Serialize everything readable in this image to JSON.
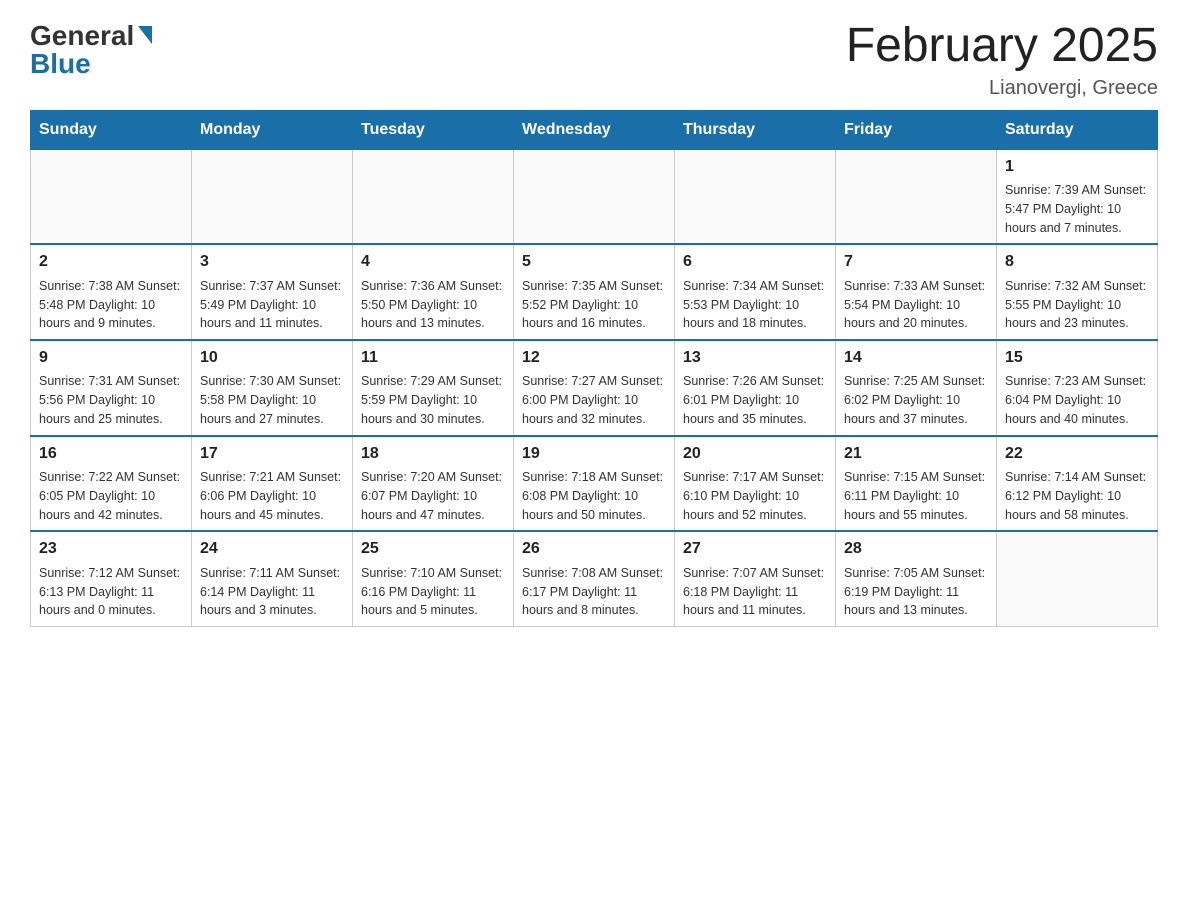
{
  "header": {
    "logo_general": "General",
    "logo_blue": "Blue",
    "title": "February 2025",
    "location": "Lianovergi, Greece"
  },
  "days_of_week": [
    "Sunday",
    "Monday",
    "Tuesday",
    "Wednesday",
    "Thursday",
    "Friday",
    "Saturday"
  ],
  "weeks": [
    [
      {
        "day": "",
        "info": ""
      },
      {
        "day": "",
        "info": ""
      },
      {
        "day": "",
        "info": ""
      },
      {
        "day": "",
        "info": ""
      },
      {
        "day": "",
        "info": ""
      },
      {
        "day": "",
        "info": ""
      },
      {
        "day": "1",
        "info": "Sunrise: 7:39 AM\nSunset: 5:47 PM\nDaylight: 10 hours\nand 7 minutes."
      }
    ],
    [
      {
        "day": "2",
        "info": "Sunrise: 7:38 AM\nSunset: 5:48 PM\nDaylight: 10 hours\nand 9 minutes."
      },
      {
        "day": "3",
        "info": "Sunrise: 7:37 AM\nSunset: 5:49 PM\nDaylight: 10 hours\nand 11 minutes."
      },
      {
        "day": "4",
        "info": "Sunrise: 7:36 AM\nSunset: 5:50 PM\nDaylight: 10 hours\nand 13 minutes."
      },
      {
        "day": "5",
        "info": "Sunrise: 7:35 AM\nSunset: 5:52 PM\nDaylight: 10 hours\nand 16 minutes."
      },
      {
        "day": "6",
        "info": "Sunrise: 7:34 AM\nSunset: 5:53 PM\nDaylight: 10 hours\nand 18 minutes."
      },
      {
        "day": "7",
        "info": "Sunrise: 7:33 AM\nSunset: 5:54 PM\nDaylight: 10 hours\nand 20 minutes."
      },
      {
        "day": "8",
        "info": "Sunrise: 7:32 AM\nSunset: 5:55 PM\nDaylight: 10 hours\nand 23 minutes."
      }
    ],
    [
      {
        "day": "9",
        "info": "Sunrise: 7:31 AM\nSunset: 5:56 PM\nDaylight: 10 hours\nand 25 minutes."
      },
      {
        "day": "10",
        "info": "Sunrise: 7:30 AM\nSunset: 5:58 PM\nDaylight: 10 hours\nand 27 minutes."
      },
      {
        "day": "11",
        "info": "Sunrise: 7:29 AM\nSunset: 5:59 PM\nDaylight: 10 hours\nand 30 minutes."
      },
      {
        "day": "12",
        "info": "Sunrise: 7:27 AM\nSunset: 6:00 PM\nDaylight: 10 hours\nand 32 minutes."
      },
      {
        "day": "13",
        "info": "Sunrise: 7:26 AM\nSunset: 6:01 PM\nDaylight: 10 hours\nand 35 minutes."
      },
      {
        "day": "14",
        "info": "Sunrise: 7:25 AM\nSunset: 6:02 PM\nDaylight: 10 hours\nand 37 minutes."
      },
      {
        "day": "15",
        "info": "Sunrise: 7:23 AM\nSunset: 6:04 PM\nDaylight: 10 hours\nand 40 minutes."
      }
    ],
    [
      {
        "day": "16",
        "info": "Sunrise: 7:22 AM\nSunset: 6:05 PM\nDaylight: 10 hours\nand 42 minutes."
      },
      {
        "day": "17",
        "info": "Sunrise: 7:21 AM\nSunset: 6:06 PM\nDaylight: 10 hours\nand 45 minutes."
      },
      {
        "day": "18",
        "info": "Sunrise: 7:20 AM\nSunset: 6:07 PM\nDaylight: 10 hours\nand 47 minutes."
      },
      {
        "day": "19",
        "info": "Sunrise: 7:18 AM\nSunset: 6:08 PM\nDaylight: 10 hours\nand 50 minutes."
      },
      {
        "day": "20",
        "info": "Sunrise: 7:17 AM\nSunset: 6:10 PM\nDaylight: 10 hours\nand 52 minutes."
      },
      {
        "day": "21",
        "info": "Sunrise: 7:15 AM\nSunset: 6:11 PM\nDaylight: 10 hours\nand 55 minutes."
      },
      {
        "day": "22",
        "info": "Sunrise: 7:14 AM\nSunset: 6:12 PM\nDaylight: 10 hours\nand 58 minutes."
      }
    ],
    [
      {
        "day": "23",
        "info": "Sunrise: 7:12 AM\nSunset: 6:13 PM\nDaylight: 11 hours\nand 0 minutes."
      },
      {
        "day": "24",
        "info": "Sunrise: 7:11 AM\nSunset: 6:14 PM\nDaylight: 11 hours\nand 3 minutes."
      },
      {
        "day": "25",
        "info": "Sunrise: 7:10 AM\nSunset: 6:16 PM\nDaylight: 11 hours\nand 5 minutes."
      },
      {
        "day": "26",
        "info": "Sunrise: 7:08 AM\nSunset: 6:17 PM\nDaylight: 11 hours\nand 8 minutes."
      },
      {
        "day": "27",
        "info": "Sunrise: 7:07 AM\nSunset: 6:18 PM\nDaylight: 11 hours\nand 11 minutes."
      },
      {
        "day": "28",
        "info": "Sunrise: 7:05 AM\nSunset: 6:19 PM\nDaylight: 11 hours\nand 13 minutes."
      },
      {
        "day": "",
        "info": ""
      }
    ]
  ]
}
